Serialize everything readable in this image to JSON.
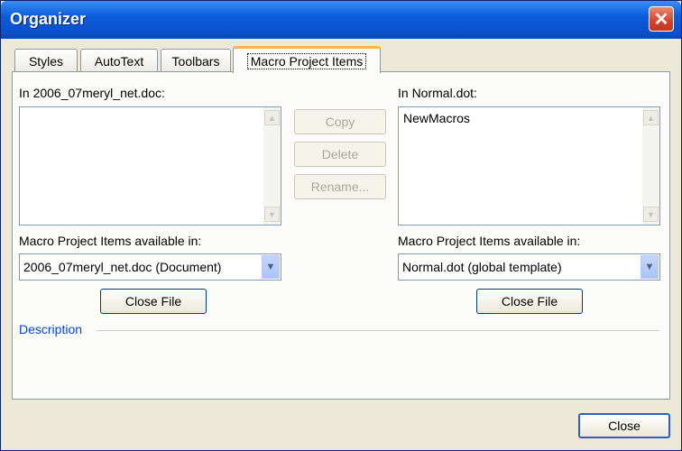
{
  "window": {
    "title": "Organizer",
    "close_glyph": "✕"
  },
  "tabs": [
    {
      "label": "Styles"
    },
    {
      "label": "AutoText"
    },
    {
      "label": "Toolbars"
    },
    {
      "label": "Macro Project Items"
    }
  ],
  "left": {
    "list_label": "In 2006_07meryl_net.doc:",
    "available_label": "Macro Project Items available in:",
    "available_value": "2006_07meryl_net.doc (Document)",
    "close_file": "Close File"
  },
  "right": {
    "list_label": "In Normal.dot:",
    "items": [
      "NewMacros"
    ],
    "available_label": "Macro Project Items available in:",
    "available_value": "Normal.dot (global template)",
    "close_file": "Close File"
  },
  "actions": {
    "copy": "Copy",
    "delete": "Delete",
    "rename": "Rename..."
  },
  "description_label": "Description",
  "close_button": "Close",
  "icons": {
    "scroll_up": "▲",
    "scroll_down": "▼",
    "dropdown": "▼"
  }
}
